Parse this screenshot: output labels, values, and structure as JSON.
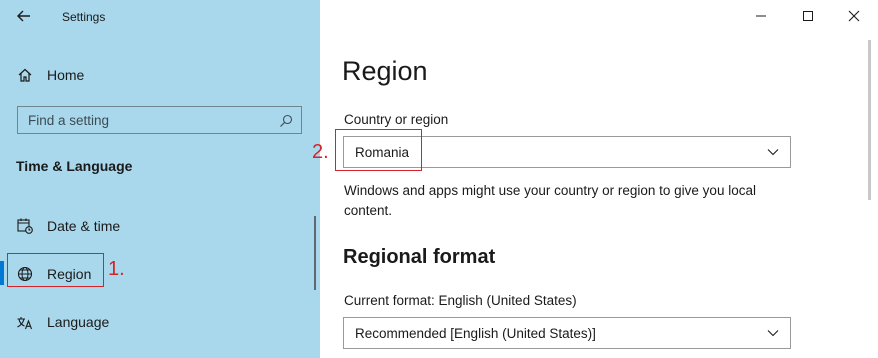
{
  "window": {
    "title": "Settings"
  },
  "sidebar": {
    "home_label": "Home",
    "search_placeholder": "Find a setting",
    "section_label": "Time & Language",
    "items": [
      {
        "label": "Date & time",
        "icon": "calendar-clock-icon"
      },
      {
        "label": "Region",
        "icon": "globe-icon",
        "active": true
      },
      {
        "label": "Language",
        "icon": "language-icon"
      }
    ]
  },
  "annotations": {
    "step1": "1.",
    "step2": "2."
  },
  "main": {
    "title": "Region",
    "country_label": "Country or region",
    "country_value": "Romania",
    "country_desc": "Windows and apps might use your country or region to give you local content.",
    "regional_format_title": "Regional format",
    "current_format_label": "Current format: English (United States)",
    "format_value": "Recommended [English (United States)]"
  },
  "colors": {
    "sidebar_bg": "#a9d8ec",
    "accent": "#0078d4",
    "annotation_red": "#d4242a"
  }
}
